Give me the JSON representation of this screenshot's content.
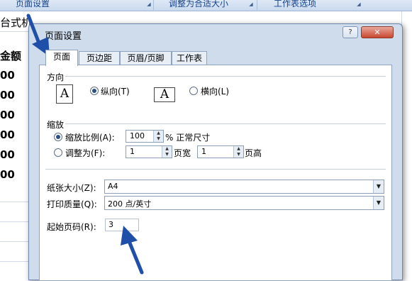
{
  "ribbon": {
    "groups": [
      {
        "label": "页面设置"
      },
      {
        "label": "调整为合适大小"
      },
      {
        "label": "工作表选项"
      }
    ]
  },
  "sheet": {
    "cell_title": "台式机",
    "column_header": "金额",
    "amounts": [
      "00",
      "00",
      "00",
      "00",
      "00",
      "00"
    ]
  },
  "dialog": {
    "title": "页面设置",
    "help_label": "?",
    "close_label": "✕",
    "tabs": [
      {
        "label": "页面",
        "active": true
      },
      {
        "label": "页边距",
        "active": false
      },
      {
        "label": "页眉/页脚",
        "active": false
      },
      {
        "label": "工作表",
        "active": false
      }
    ],
    "orientation": {
      "section_label": "方向",
      "portrait": {
        "label": "纵向(T)",
        "icon_letter": "A",
        "selected": true
      },
      "landscape": {
        "label": "横向(L)",
        "icon_letter": "A",
        "selected": false
      }
    },
    "scaling": {
      "section_label": "缩放",
      "adjust_to": {
        "label": "缩放比例(A):",
        "value": "100",
        "suffix": "% 正常尺寸",
        "selected": true
      },
      "fit_to": {
        "label": "调整为(F):",
        "pages_wide": "1",
        "wide_label": "页宽",
        "pages_tall": "1",
        "tall_label": "页高",
        "selected": false
      }
    },
    "paper_size": {
      "label": "纸张大小(Z):",
      "value": "A4"
    },
    "print_quality": {
      "label": "打印质量(Q):",
      "value": "200 点/英寸"
    },
    "first_page_number": {
      "label": "起始页码(R):",
      "value": "3"
    }
  },
  "colors": {
    "arrow": "#1f4fa8",
    "dialog_bg": "#cfdcec",
    "ribbon_text": "#15428b"
  }
}
